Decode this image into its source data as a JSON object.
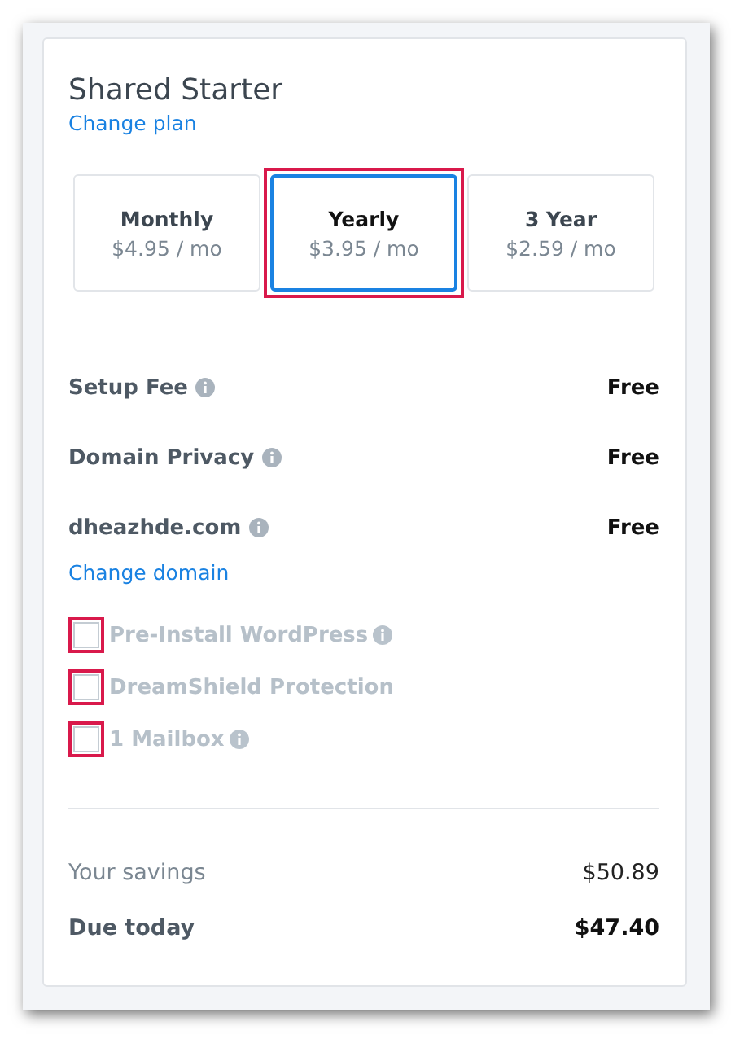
{
  "plan": {
    "title": "Shared Starter",
    "change_link": "Change plan"
  },
  "billing_options": [
    {
      "label": "Monthly",
      "price": "$4.95 / mo",
      "selected": false,
      "highlighted": false
    },
    {
      "label": "Yearly",
      "price": "$3.95 / mo",
      "selected": true,
      "highlighted": true
    },
    {
      "label": "3 Year",
      "price": "$2.59 / mo",
      "selected": false,
      "highlighted": false
    }
  ],
  "fees": [
    {
      "label": "Setup Fee",
      "info": true,
      "value": "Free"
    },
    {
      "label": "Domain Privacy",
      "info": true,
      "value": "Free"
    },
    {
      "label": "dheazhde.com",
      "info": true,
      "value": "Free"
    }
  ],
  "change_domain": "Change domain",
  "addons": [
    {
      "label": "Pre-Install WordPress",
      "info": true,
      "checked": false,
      "highlighted": true
    },
    {
      "label": "DreamShield Protection",
      "info": false,
      "checked": false,
      "highlighted": true
    },
    {
      "label": "1 Mailbox",
      "info": true,
      "checked": false,
      "highlighted": true
    }
  ],
  "totals": [
    {
      "kind": "savings",
      "label": "Your savings",
      "value": "$50.89"
    },
    {
      "kind": "due",
      "label": "Due today",
      "value": "$47.40"
    }
  ]
}
